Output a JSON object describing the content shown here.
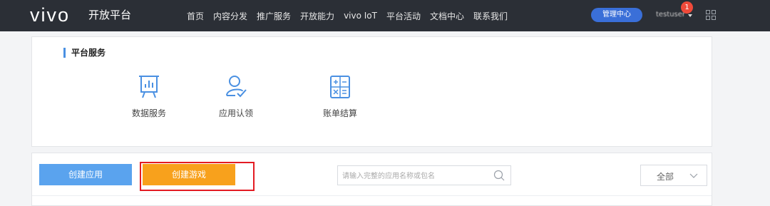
{
  "header": {
    "logo": "vivo",
    "platform_name": "开放平台",
    "nav": [
      "首页",
      "内容分发",
      "推广服务",
      "开放能力",
      "vivo IoT",
      "平台活动",
      "文档中心",
      "联系我们"
    ],
    "manage_button": "管理中心",
    "username": "testuser",
    "notification_count": "1"
  },
  "services": {
    "title": "平台服务",
    "items": [
      {
        "label": "数据服务",
        "icon": "data-chart-icon"
      },
      {
        "label": "应用认领",
        "icon": "user-check-icon"
      },
      {
        "label": "账单结算",
        "icon": "calculator-icon"
      }
    ]
  },
  "toolbar": {
    "create_app": "创建应用",
    "create_game": "创建游戏",
    "search_placeholder": "请输入完整的应用名称或包名",
    "filter_value": "全部"
  },
  "colors": {
    "topbar": "#2b2f36",
    "accent": "#4a90e2",
    "create_app": "#5aa3ee",
    "create_game": "#f8a11c",
    "highlight": "#e31b23"
  }
}
